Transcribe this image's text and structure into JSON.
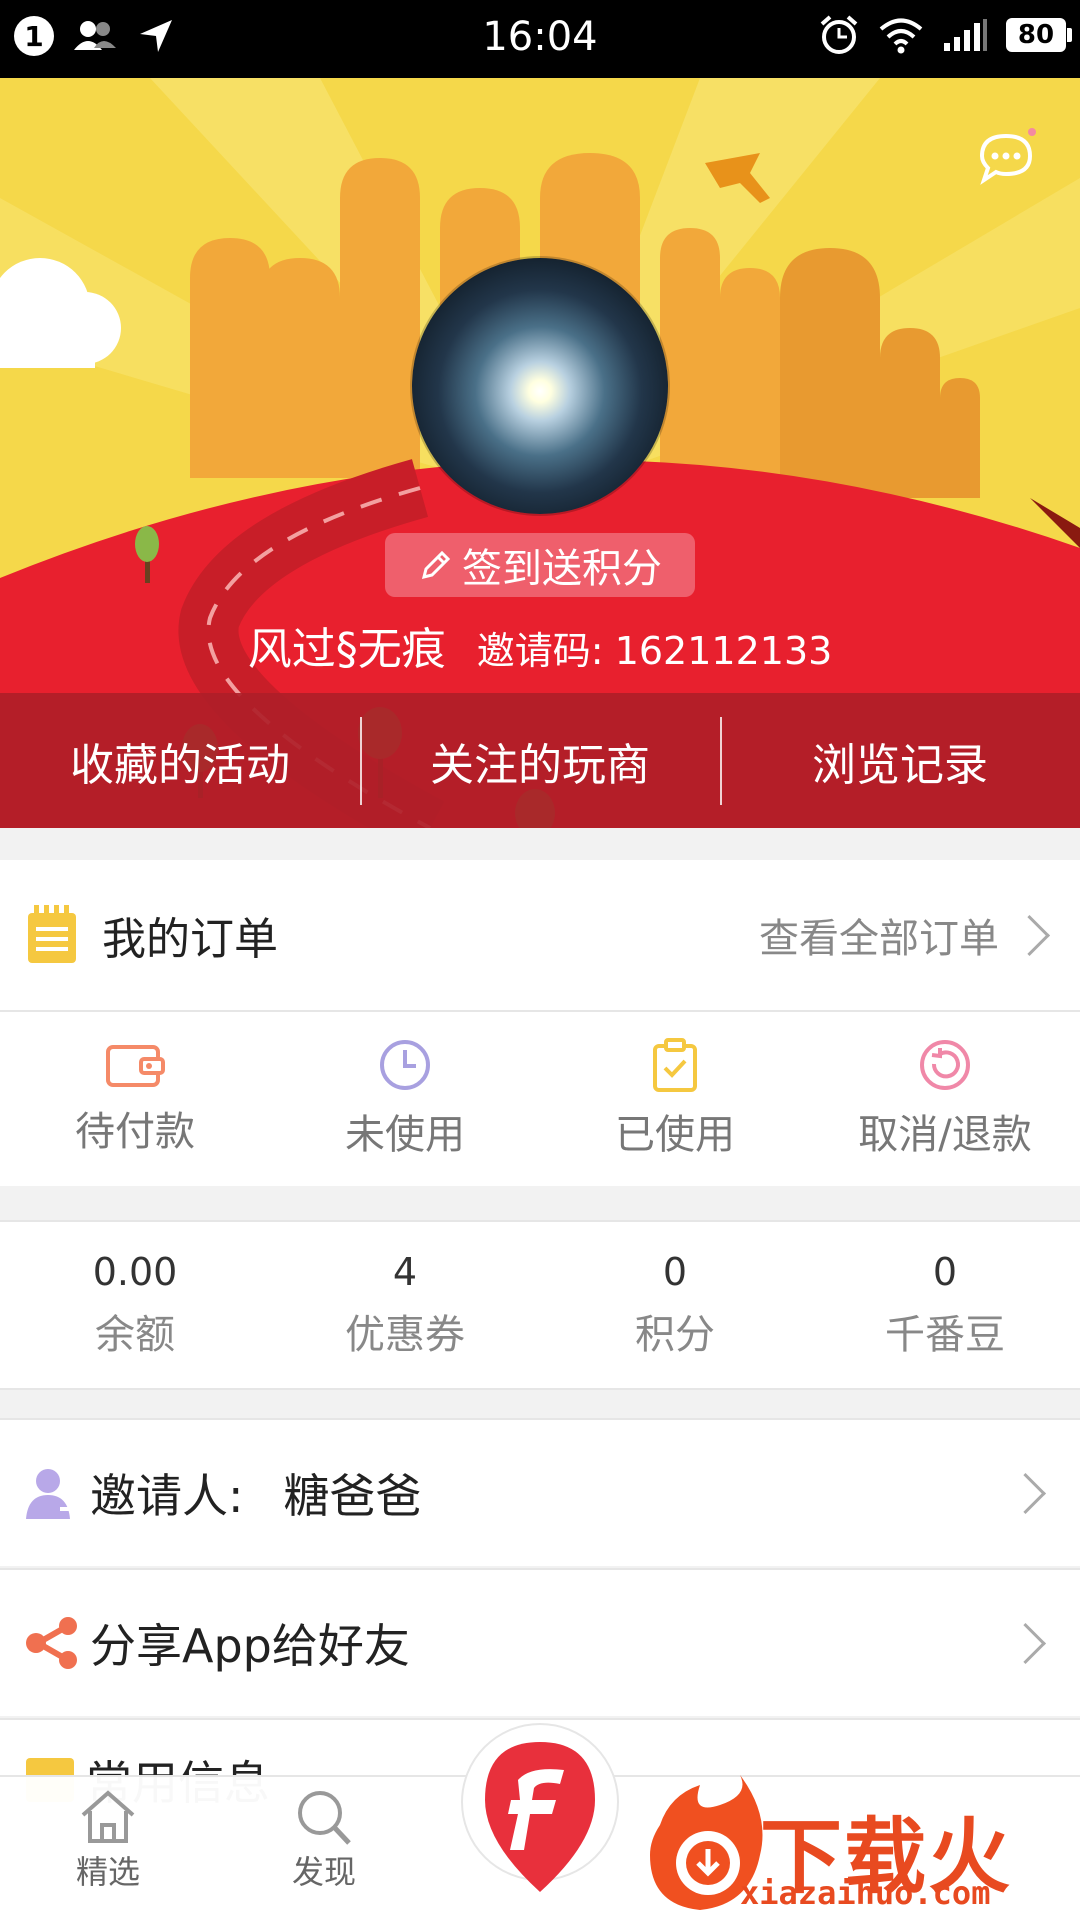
{
  "status_bar": {
    "notification_count": "1",
    "time": "16:04",
    "battery": "80"
  },
  "header": {
    "signin_label": "签到送积分",
    "username": "风过§无痕",
    "invite_code_label": "邀请码:",
    "invite_code": "162112133",
    "tabs": [
      "收藏的活动",
      "关注的玩商",
      "浏览记录"
    ]
  },
  "orders": {
    "title": "我的订单",
    "view_all": "查看全部订单",
    "statuses": [
      {
        "label": "待付款",
        "icon": "wallet-icon",
        "color": "#f58a68"
      },
      {
        "label": "未使用",
        "icon": "clock-icon",
        "color": "#a8a0e0"
      },
      {
        "label": "已使用",
        "icon": "clipboard-check-icon",
        "color": "#f5c840"
      },
      {
        "label": "取消/退款",
        "icon": "refund-icon",
        "color": "#f088a8"
      }
    ]
  },
  "assets": [
    {
      "value": "0.00",
      "label": "余额"
    },
    {
      "value": "4",
      "label": "优惠券"
    },
    {
      "value": "0",
      "label": "积分"
    },
    {
      "value": "0",
      "label": "千番豆"
    }
  ],
  "rows": {
    "inviter_label": "邀请人:",
    "inviter_name": "糖爸爸",
    "share_label": "分享App给好友",
    "partial_label": "常用信息"
  },
  "bottom_nav": {
    "home": "精选",
    "discover": "发现"
  },
  "watermark": {
    "title": "下载火",
    "domain": "xiazaihuo.com"
  },
  "colors": {
    "hero_red": "#e8202e",
    "hero_yellow": "#f5d84a",
    "tabs_bg": "#b01e28",
    "accent_orange": "#e84a20"
  }
}
